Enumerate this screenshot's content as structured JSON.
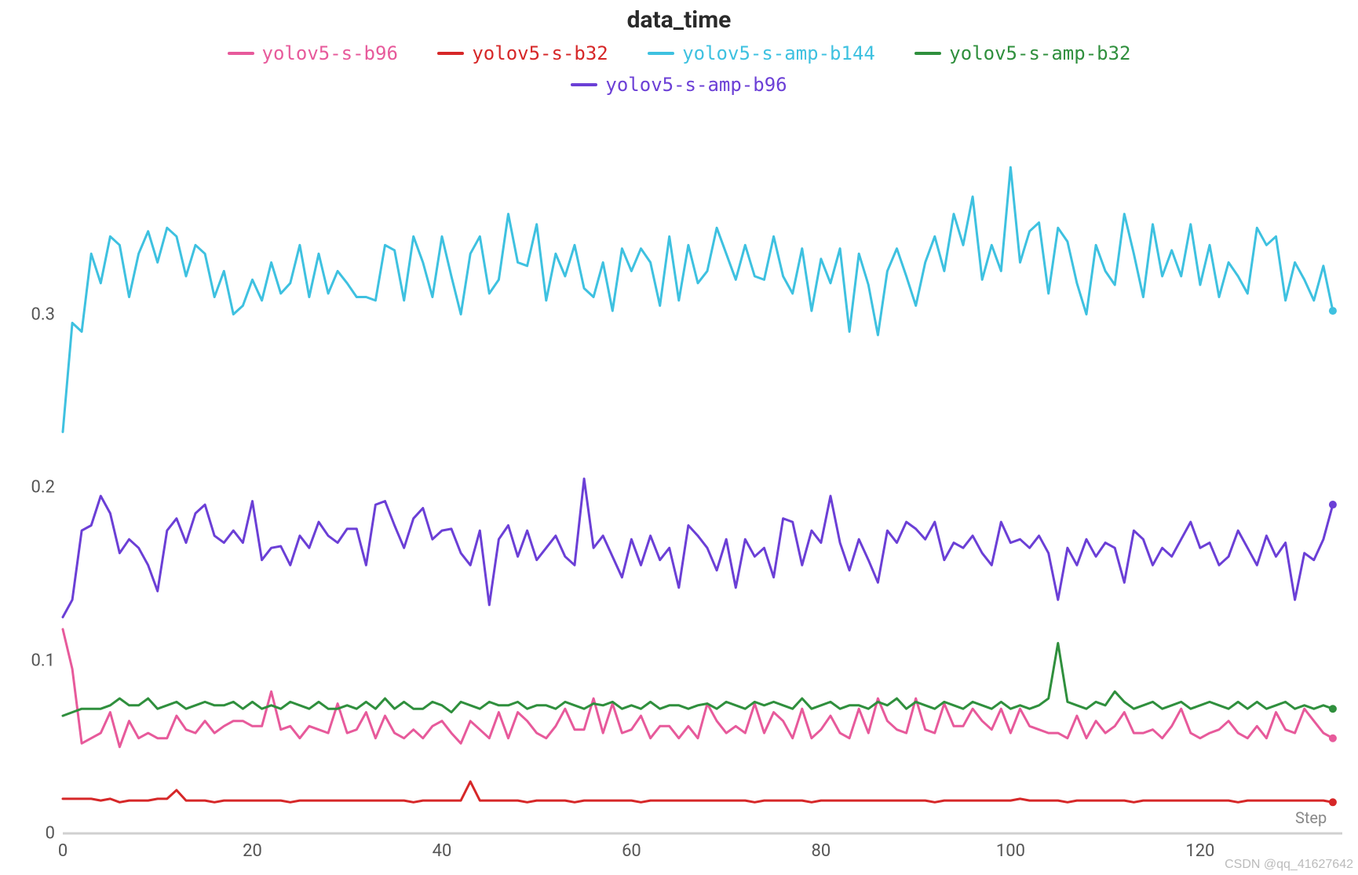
{
  "chart_data": {
    "type": "line",
    "title": "data_time",
    "xlabel": "Step",
    "ylabel": "",
    "xlim": [
      0,
      135
    ],
    "ylim": [
      0,
      0.4
    ],
    "x_ticks": [
      0,
      20,
      40,
      60,
      80,
      100,
      120
    ],
    "y_ticks": [
      0,
      0.1,
      0.2,
      0.3
    ],
    "watermark": "CSDN @qq_41627642",
    "categories": [
      0,
      1,
      2,
      3,
      4,
      5,
      6,
      7,
      8,
      9,
      10,
      11,
      12,
      13,
      14,
      15,
      16,
      17,
      18,
      19,
      20,
      21,
      22,
      23,
      24,
      25,
      26,
      27,
      28,
      29,
      30,
      31,
      32,
      33,
      34,
      35,
      36,
      37,
      38,
      39,
      40,
      41,
      42,
      43,
      44,
      45,
      46,
      47,
      48,
      49,
      50,
      51,
      52,
      53,
      54,
      55,
      56,
      57,
      58,
      59,
      60,
      61,
      62,
      63,
      64,
      65,
      66,
      67,
      68,
      69,
      70,
      71,
      72,
      73,
      74,
      75,
      76,
      77,
      78,
      79,
      80,
      81,
      82,
      83,
      84,
      85,
      86,
      87,
      88,
      89,
      90,
      91,
      92,
      93,
      94,
      95,
      96,
      97,
      98,
      99,
      100,
      101,
      102,
      103,
      104,
      105,
      106,
      107,
      108,
      109,
      110,
      111,
      112,
      113,
      114,
      115,
      116,
      117,
      118,
      119,
      120,
      121,
      122,
      123,
      124,
      125,
      126,
      127,
      128,
      129,
      130,
      131,
      132,
      133,
      134
    ],
    "series": [
      {
        "name": "yolov5-s-b96",
        "color": "#e75a9b",
        "values": [
          0.118,
          0.095,
          0.052,
          0.055,
          0.058,
          0.07,
          0.05,
          0.065,
          0.055,
          0.058,
          0.055,
          0.055,
          0.068,
          0.06,
          0.058,
          0.065,
          0.058,
          0.062,
          0.065,
          0.065,
          0.062,
          0.062,
          0.082,
          0.06,
          0.062,
          0.055,
          0.062,
          0.06,
          0.058,
          0.075,
          0.058,
          0.06,
          0.07,
          0.055,
          0.068,
          0.058,
          0.055,
          0.06,
          0.055,
          0.062,
          0.065,
          0.058,
          0.052,
          0.065,
          0.06,
          0.055,
          0.07,
          0.055,
          0.07,
          0.065,
          0.058,
          0.055,
          0.062,
          0.072,
          0.06,
          0.06,
          0.078,
          0.058,
          0.075,
          0.058,
          0.06,
          0.068,
          0.055,
          0.062,
          0.062,
          0.055,
          0.062,
          0.055,
          0.075,
          0.065,
          0.058,
          0.062,
          0.058,
          0.075,
          0.058,
          0.07,
          0.065,
          0.055,
          0.072,
          0.055,
          0.06,
          0.068,
          0.058,
          0.055,
          0.072,
          0.058,
          0.078,
          0.065,
          0.06,
          0.058,
          0.078,
          0.06,
          0.058,
          0.075,
          0.062,
          0.062,
          0.072,
          0.065,
          0.06,
          0.072,
          0.058,
          0.072,
          0.062,
          0.06,
          0.058,
          0.058,
          0.055,
          0.068,
          0.055,
          0.065,
          0.058,
          0.062,
          0.07,
          0.058,
          0.058,
          0.06,
          0.055,
          0.062,
          0.072,
          0.058,
          0.055,
          0.058,
          0.06,
          0.065,
          0.058,
          0.055,
          0.062,
          0.055,
          0.07,
          0.06,
          0.058,
          0.072,
          0.065,
          0.058,
          0.055
        ]
      },
      {
        "name": "yolov5-s-b32",
        "color": "#d62728",
        "values": [
          0.02,
          0.02,
          0.02,
          0.02,
          0.019,
          0.02,
          0.018,
          0.019,
          0.019,
          0.019,
          0.02,
          0.02,
          0.025,
          0.019,
          0.019,
          0.019,
          0.018,
          0.019,
          0.019,
          0.019,
          0.019,
          0.019,
          0.019,
          0.019,
          0.018,
          0.019,
          0.019,
          0.019,
          0.019,
          0.019,
          0.019,
          0.019,
          0.019,
          0.019,
          0.019,
          0.019,
          0.019,
          0.018,
          0.019,
          0.019,
          0.019,
          0.019,
          0.019,
          0.03,
          0.019,
          0.019,
          0.019,
          0.019,
          0.019,
          0.018,
          0.019,
          0.019,
          0.019,
          0.019,
          0.018,
          0.019,
          0.019,
          0.019,
          0.019,
          0.019,
          0.019,
          0.018,
          0.019,
          0.019,
          0.019,
          0.019,
          0.019,
          0.019,
          0.019,
          0.019,
          0.019,
          0.019,
          0.019,
          0.018,
          0.019,
          0.019,
          0.019,
          0.019,
          0.019,
          0.018,
          0.019,
          0.019,
          0.019,
          0.019,
          0.019,
          0.019,
          0.019,
          0.019,
          0.019,
          0.019,
          0.019,
          0.019,
          0.018,
          0.019,
          0.019,
          0.019,
          0.019,
          0.019,
          0.019,
          0.019,
          0.019,
          0.02,
          0.019,
          0.019,
          0.019,
          0.019,
          0.018,
          0.019,
          0.019,
          0.019,
          0.019,
          0.019,
          0.019,
          0.018,
          0.019,
          0.019,
          0.019,
          0.019,
          0.019,
          0.019,
          0.019,
          0.019,
          0.019,
          0.019,
          0.018,
          0.019,
          0.019,
          0.019,
          0.019,
          0.019,
          0.019,
          0.019,
          0.019,
          0.019,
          0.018
        ]
      },
      {
        "name": "yolov5-s-amp-b144",
        "color": "#3ec1e0",
        "values": [
          0.232,
          0.295,
          0.29,
          0.335,
          0.318,
          0.345,
          0.34,
          0.31,
          0.335,
          0.348,
          0.33,
          0.35,
          0.345,
          0.322,
          0.34,
          0.335,
          0.31,
          0.325,
          0.3,
          0.305,
          0.32,
          0.308,
          0.33,
          0.312,
          0.318,
          0.34,
          0.31,
          0.335,
          0.312,
          0.325,
          0.318,
          0.31,
          0.31,
          0.308,
          0.34,
          0.337,
          0.308,
          0.345,
          0.33,
          0.31,
          0.345,
          0.322,
          0.3,
          0.335,
          0.345,
          0.312,
          0.32,
          0.358,
          0.33,
          0.328,
          0.352,
          0.308,
          0.335,
          0.322,
          0.34,
          0.315,
          0.31,
          0.33,
          0.302,
          0.338,
          0.325,
          0.338,
          0.33,
          0.305,
          0.345,
          0.308,
          0.34,
          0.318,
          0.325,
          0.35,
          0.335,
          0.32,
          0.34,
          0.322,
          0.32,
          0.345,
          0.322,
          0.312,
          0.338,
          0.302,
          0.332,
          0.318,
          0.338,
          0.29,
          0.335,
          0.317,
          0.288,
          0.325,
          0.338,
          0.322,
          0.305,
          0.33,
          0.345,
          0.325,
          0.358,
          0.34,
          0.368,
          0.32,
          0.34,
          0.325,
          0.385,
          0.33,
          0.348,
          0.353,
          0.312,
          0.35,
          0.342,
          0.318,
          0.3,
          0.34,
          0.325,
          0.317,
          0.358,
          0.335,
          0.31,
          0.352,
          0.322,
          0.337,
          0.322,
          0.352,
          0.317,
          0.34,
          0.31,
          0.33,
          0.322,
          0.312,
          0.35,
          0.34,
          0.345,
          0.308,
          0.33,
          0.32,
          0.308,
          0.328,
          0.302
        ]
      },
      {
        "name": "yolov5-s-amp-b32",
        "color": "#2f8f3d",
        "values": [
          0.068,
          0.07,
          0.072,
          0.072,
          0.072,
          0.074,
          0.078,
          0.074,
          0.074,
          0.078,
          0.072,
          0.074,
          0.076,
          0.072,
          0.074,
          0.076,
          0.074,
          0.074,
          0.076,
          0.072,
          0.076,
          0.072,
          0.074,
          0.072,
          0.076,
          0.074,
          0.072,
          0.076,
          0.072,
          0.072,
          0.074,
          0.072,
          0.076,
          0.072,
          0.078,
          0.072,
          0.076,
          0.072,
          0.072,
          0.076,
          0.074,
          0.07,
          0.076,
          0.074,
          0.072,
          0.076,
          0.074,
          0.074,
          0.076,
          0.072,
          0.074,
          0.074,
          0.072,
          0.076,
          0.074,
          0.072,
          0.075,
          0.074,
          0.076,
          0.072,
          0.074,
          0.072,
          0.076,
          0.072,
          0.074,
          0.074,
          0.072,
          0.074,
          0.075,
          0.072,
          0.076,
          0.074,
          0.072,
          0.076,
          0.074,
          0.076,
          0.074,
          0.072,
          0.078,
          0.072,
          0.074,
          0.076,
          0.072,
          0.074,
          0.074,
          0.072,
          0.076,
          0.074,
          0.078,
          0.072,
          0.076,
          0.074,
          0.072,
          0.076,
          0.074,
          0.072,
          0.076,
          0.074,
          0.072,
          0.076,
          0.072,
          0.074,
          0.072,
          0.074,
          0.078,
          0.11,
          0.076,
          0.074,
          0.072,
          0.076,
          0.074,
          0.082,
          0.076,
          0.072,
          0.074,
          0.076,
          0.072,
          0.074,
          0.076,
          0.072,
          0.074,
          0.076,
          0.074,
          0.072,
          0.076,
          0.072,
          0.076,
          0.072,
          0.074,
          0.076,
          0.072,
          0.074,
          0.072,
          0.074,
          0.072
        ]
      },
      {
        "name": "yolov5-s-amp-b96",
        "color": "#6b3fd6",
        "values": [
          0.125,
          0.135,
          0.175,
          0.178,
          0.195,
          0.185,
          0.162,
          0.17,
          0.165,
          0.155,
          0.14,
          0.175,
          0.182,
          0.168,
          0.185,
          0.19,
          0.172,
          0.168,
          0.175,
          0.168,
          0.192,
          0.158,
          0.165,
          0.166,
          0.155,
          0.172,
          0.165,
          0.18,
          0.172,
          0.168,
          0.176,
          0.176,
          0.155,
          0.19,
          0.192,
          0.178,
          0.165,
          0.182,
          0.188,
          0.17,
          0.175,
          0.176,
          0.162,
          0.155,
          0.175,
          0.132,
          0.17,
          0.178,
          0.16,
          0.175,
          0.158,
          0.165,
          0.172,
          0.16,
          0.155,
          0.205,
          0.165,
          0.172,
          0.16,
          0.148,
          0.17,
          0.155,
          0.172,
          0.158,
          0.165,
          0.142,
          0.178,
          0.172,
          0.165,
          0.152,
          0.17,
          0.142,
          0.17,
          0.16,
          0.165,
          0.148,
          0.182,
          0.18,
          0.155,
          0.175,
          0.168,
          0.195,
          0.168,
          0.152,
          0.17,
          0.158,
          0.145,
          0.175,
          0.168,
          0.18,
          0.176,
          0.17,
          0.18,
          0.158,
          0.168,
          0.165,
          0.172,
          0.162,
          0.155,
          0.18,
          0.168,
          0.17,
          0.165,
          0.172,
          0.162,
          0.135,
          0.165,
          0.155,
          0.17,
          0.16,
          0.168,
          0.165,
          0.145,
          0.175,
          0.17,
          0.155,
          0.165,
          0.16,
          0.17,
          0.18,
          0.165,
          0.168,
          0.155,
          0.16,
          0.175,
          0.165,
          0.155,
          0.172,
          0.16,
          0.168,
          0.135,
          0.162,
          0.158,
          0.17,
          0.19
        ]
      }
    ]
  }
}
